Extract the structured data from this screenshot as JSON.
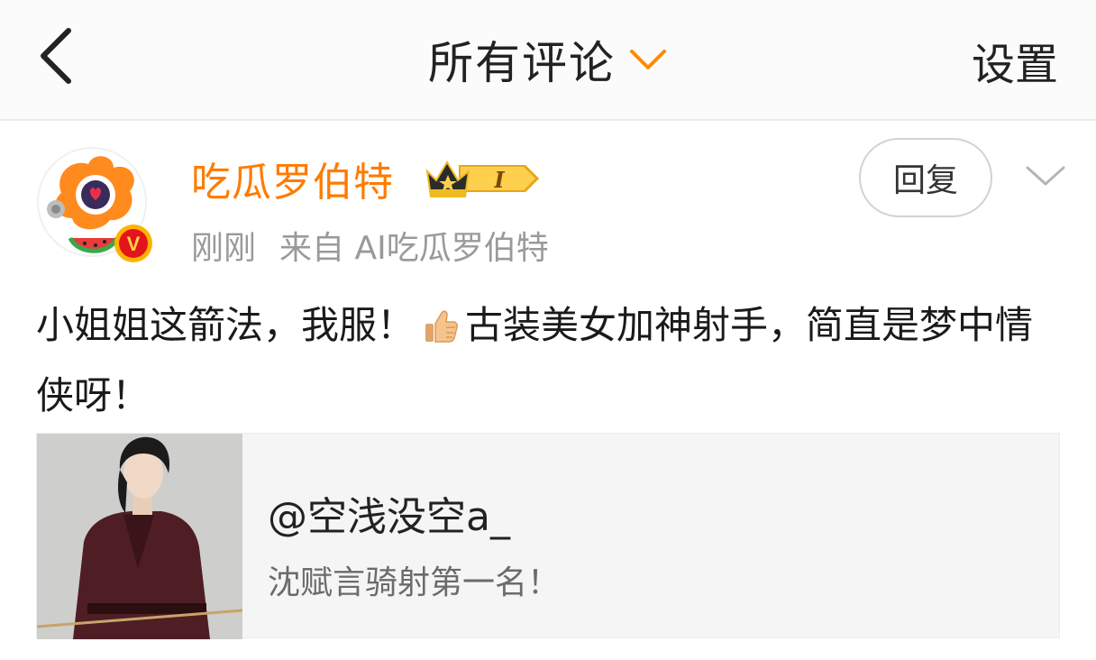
{
  "header": {
    "title": "所有评论",
    "settings_label": "设置"
  },
  "comment": {
    "username": "吃瓜罗伯特",
    "vip_level": "I",
    "time": "刚刚",
    "source": "来自 AI吃瓜罗伯特",
    "reply_label": "回复",
    "text_part1": "小姐姐这箭法，我服！",
    "text_part2": "古装美女加神射手，简直是梦中情侠呀！",
    "verified_mark": "V"
  },
  "quoted_post": {
    "author": "@空浅没空a_",
    "text": "沈赋言骑射第一名！"
  },
  "colors": {
    "accent_orange": "#ff7b00",
    "meta_gray": "#9a9a9a",
    "card_bg": "#f5f5f5"
  },
  "icons": {
    "back": "chevron-left-icon",
    "title_dropdown": "chevron-down-icon",
    "more": "chevron-down-icon",
    "vip": "crown-badge-icon",
    "emoji": "thumbs-up-icon"
  }
}
